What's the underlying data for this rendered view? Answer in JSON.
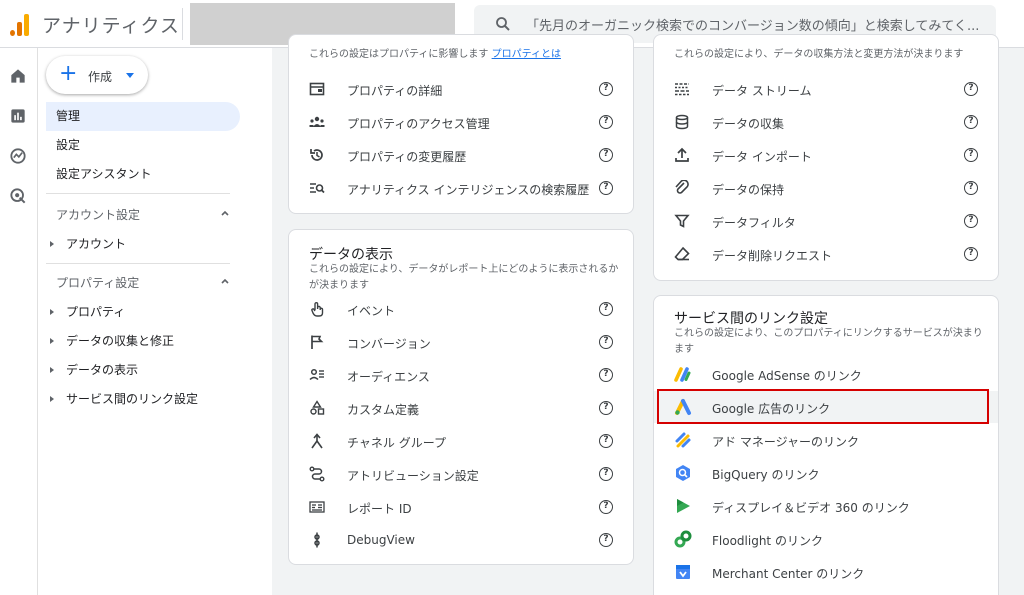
{
  "app": {
    "title": "アナリティクス"
  },
  "search": {
    "placeholder": "「先月のオーガニック検索でのコンバージョン数の傾向」と検索してみてく..."
  },
  "create": {
    "label": "作成"
  },
  "nav": {
    "items": [
      {
        "label": "管理",
        "active": true
      },
      {
        "label": "設定"
      },
      {
        "label": "設定アシスタント"
      }
    ],
    "account_section": "アカウント設定",
    "account_items": [
      "アカウント"
    ],
    "property_section": "プロパティ設定",
    "property_items": [
      "プロパティ",
      "データの収集と修正",
      "データの表示",
      "サービス間のリンク設定"
    ]
  },
  "card_property": {
    "desc": "これらの設定はプロパティに影響します",
    "desc_link": "プロパティとは",
    "rows": [
      {
        "label": "プロパティの詳細",
        "icon": "property-details-icon"
      },
      {
        "label": "プロパティのアクセス管理",
        "icon": "access-management-icon"
      },
      {
        "label": "プロパティの変更履歴",
        "icon": "history-icon"
      },
      {
        "label": "アナリティクス インテリジェンスの検索履歴",
        "icon": "search-history-icon"
      }
    ]
  },
  "card_data_collection": {
    "desc": "これらの設定により、データの収集方法と変更方法が決まります",
    "rows": [
      {
        "label": "データ ストリーム",
        "icon": "data-stream-icon"
      },
      {
        "label": "データの収集",
        "icon": "database-icon"
      },
      {
        "label": "データ インポート",
        "icon": "upload-icon"
      },
      {
        "label": "データの保持",
        "icon": "retention-icon"
      },
      {
        "label": "データフィルタ",
        "icon": "filter-icon"
      },
      {
        "label": "データ削除リクエスト",
        "icon": "eraser-icon"
      }
    ]
  },
  "card_data_display": {
    "title": "データの表示",
    "desc": "これらの設定により、データがレポート上にどのように表示されるかが決まります",
    "rows": [
      {
        "label": "イベント",
        "icon": "touch-icon"
      },
      {
        "label": "コンバージョン",
        "icon": "flag-icon"
      },
      {
        "label": "オーディエンス",
        "icon": "audience-icon"
      },
      {
        "label": "カスタム定義",
        "icon": "shapes-icon"
      },
      {
        "label": "チャネル グループ",
        "icon": "merge-icon"
      },
      {
        "label": "アトリビューション設定",
        "icon": "route-icon"
      },
      {
        "label": "レポート ID",
        "icon": "report-id-icon"
      },
      {
        "label": "DebugView",
        "icon": "debug-icon"
      }
    ]
  },
  "card_links": {
    "title": "サービス間のリンク設定",
    "desc": "これらの設定により、このプロパティにリンクするサービスが決まります",
    "rows": [
      {
        "label": "Google AdSense のリンク",
        "icon": "adsense-icon"
      },
      {
        "label": "Google 広告のリンク",
        "icon": "google-ads-icon",
        "highlighted": true
      },
      {
        "label": "アド マネージャーのリンク",
        "icon": "ad-manager-icon"
      },
      {
        "label": "BigQuery のリンク",
        "icon": "bigquery-icon"
      },
      {
        "label": "ディスプレイ＆ビデオ 360 のリンク",
        "icon": "dv360-icon"
      },
      {
        "label": "Floodlight のリンク",
        "icon": "floodlight-icon"
      },
      {
        "label": "Merchant Center のリンク",
        "icon": "merchant-center-icon"
      }
    ]
  },
  "help_glyph": "?",
  "colors": {
    "accent": "#1a73e8",
    "highlight_box": "#d50000",
    "active_nav": "#e8f0fe"
  }
}
